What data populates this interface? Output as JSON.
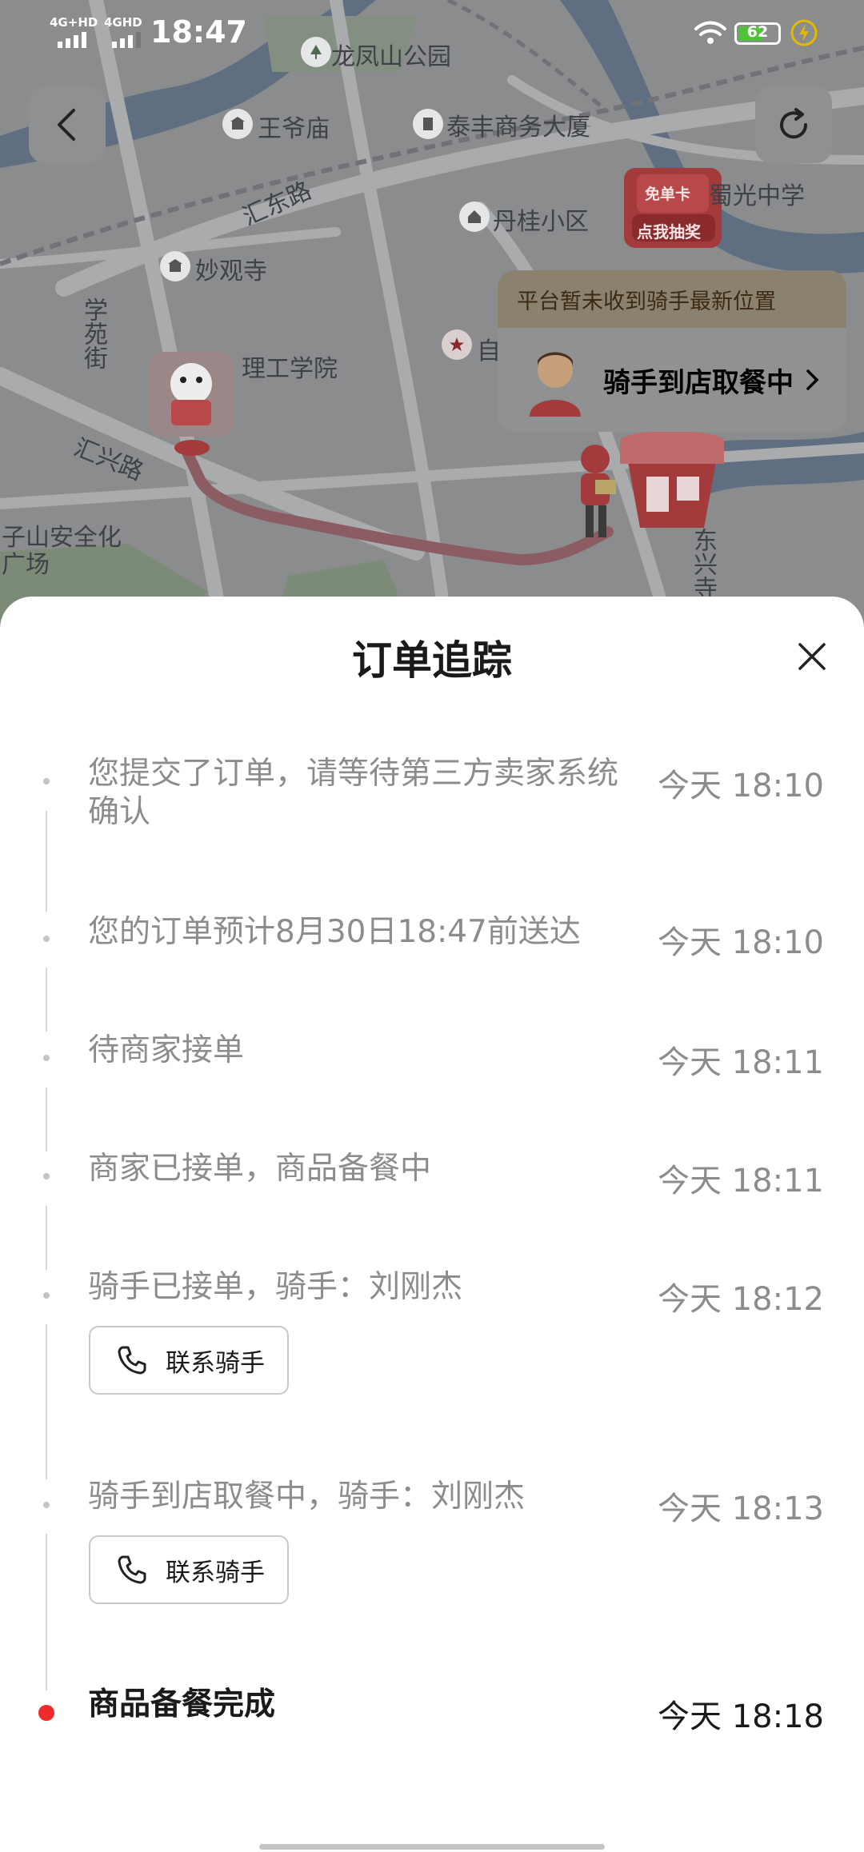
{
  "status_bar": {
    "time": "18:47",
    "network_1": "4G+HD",
    "network_2": "4GHD",
    "battery": "62",
    "battery_level": 0.62
  },
  "map": {
    "labels": {
      "park": "龙凤山公园",
      "temple1": "王爷庙",
      "building": "泰丰商务大厦",
      "road1": "汇东路",
      "school": "蜀光中学",
      "community": "丹桂小区",
      "temple2": "妙观寺",
      "street": "学苑街",
      "college": "理工学院",
      "road2": "汇兴路",
      "square": "子山安全化广场",
      "road3": "东兴寺",
      "poi_self": "自"
    },
    "promo": {
      "top": "免单卡",
      "bottom": "点我抽奖"
    },
    "rider_card": {
      "notice": "平台暂未收到骑手最新位置",
      "status": "骑手到店取餐中"
    }
  },
  "sheet": {
    "title": "订单追踪",
    "events": [
      {
        "text": "您提交了订单，请等待第三方卖家系统确认",
        "time": "今天 18:10",
        "active": false
      },
      {
        "text": "您的订单预计8月30日18:47前送达",
        "time": "今天 18:10",
        "active": false
      },
      {
        "text": "待商家接单",
        "time": "今天 18:11",
        "active": false
      },
      {
        "text": "商家已接单，商品备餐中",
        "time": "今天 18:11",
        "active": false
      },
      {
        "text": "骑手已接单，骑手：刘刚杰",
        "time": "今天 18:12",
        "active": false,
        "button": "联系骑手"
      },
      {
        "text": "骑手到店取餐中，骑手：刘刚杰",
        "time": "今天 18:13",
        "active": false,
        "button": "联系骑手"
      },
      {
        "text": "商品备餐完成",
        "time": "今天 18:18",
        "active": true
      }
    ]
  },
  "colors": {
    "accent_red": "#ee2b2b",
    "muted_text": "#8c8c8c",
    "dark_text": "#1a1a1a"
  }
}
